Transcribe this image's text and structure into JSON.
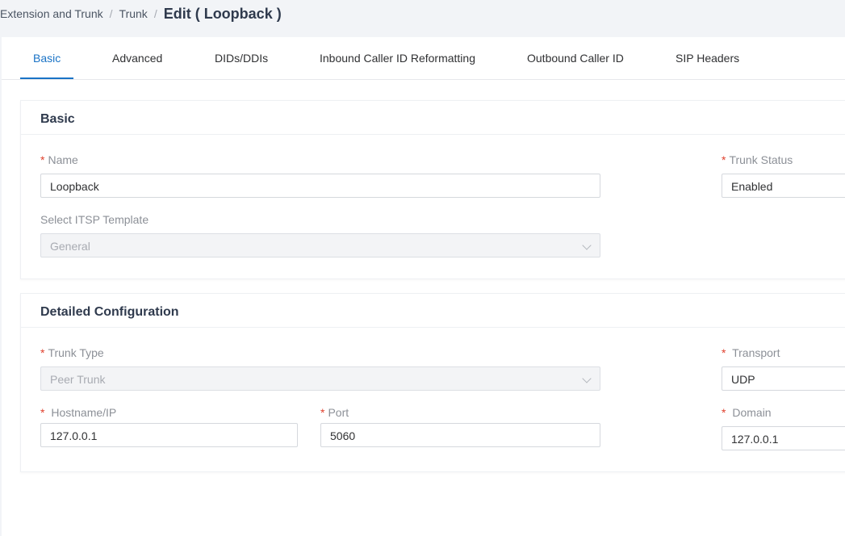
{
  "breadcrumb": {
    "item1": "Extension and Trunk",
    "item2": "Trunk",
    "separator": "/",
    "current": "Edit ( Loopback )"
  },
  "tabs": [
    {
      "label": "Basic",
      "active": true
    },
    {
      "label": "Advanced",
      "active": false
    },
    {
      "label": "DIDs/DDIs",
      "active": false
    },
    {
      "label": "Inbound Caller ID Reformatting",
      "active": false
    },
    {
      "label": "Outbound Caller ID",
      "active": false
    },
    {
      "label": "SIP Headers",
      "active": false
    }
  ],
  "basic": {
    "title": "Basic",
    "name_label": "Name",
    "name_value": "Loopback",
    "trunk_status_label": "Trunk Status",
    "trunk_status_value": "Enabled",
    "itsp_label": "Select ITSP Template",
    "itsp_value": "General"
  },
  "detailed": {
    "title": "Detailed Configuration",
    "trunk_type_label": "Trunk Type",
    "trunk_type_value": "Peer Trunk",
    "transport_label": "Transport",
    "transport_value": "UDP",
    "hostname_label": "Hostname/IP",
    "hostname_value": "127.0.0.1",
    "port_label": "Port",
    "port_value": "5060",
    "domain_label": "Domain",
    "domain_value": "127.0.0.1"
  },
  "required_marker": "*",
  "colors": {
    "accent": "#1a73c6",
    "required": "#e0412e",
    "page_bg": "#f2f4f7"
  },
  "icons": {
    "select_arrow": "chevron-down-icon"
  }
}
